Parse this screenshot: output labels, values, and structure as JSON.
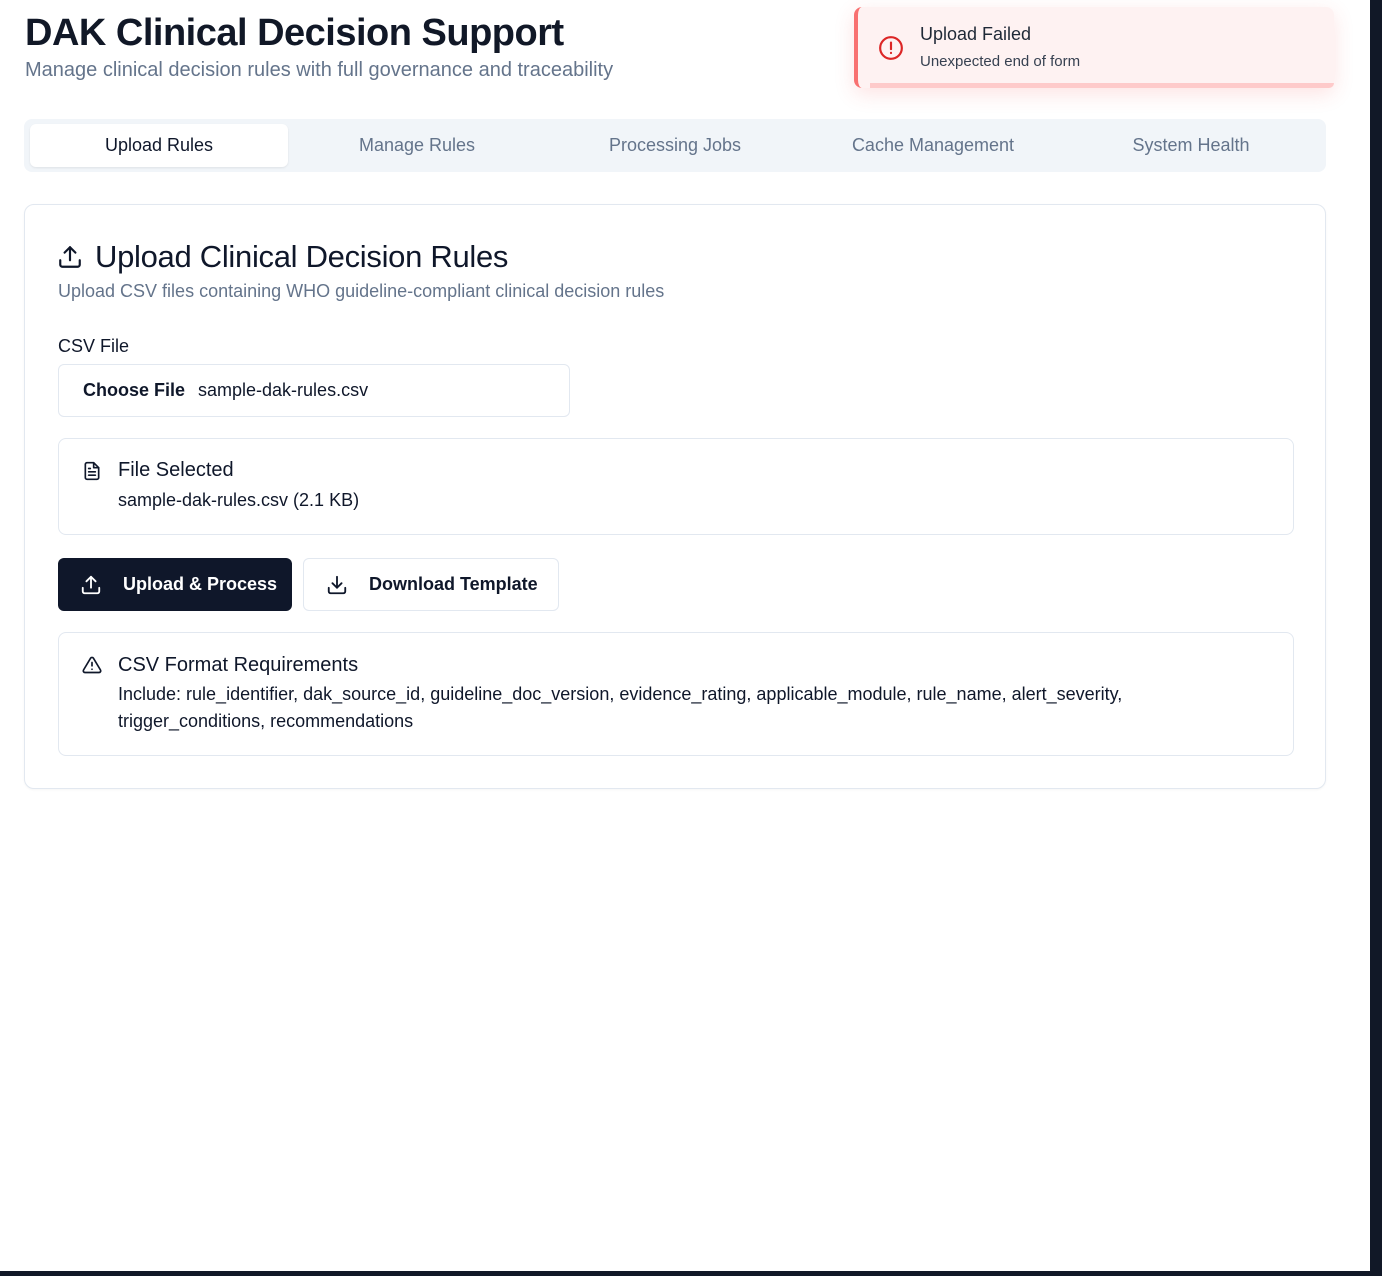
{
  "header": {
    "title": "DAK Clinical Decision Support",
    "subtitle": "Manage clinical decision rules with full governance and traceability"
  },
  "toast": {
    "title": "Upload Failed",
    "message": "Unexpected end of form",
    "icon": "alert-circle-icon",
    "accent": "#ef4444"
  },
  "tabs": [
    {
      "label": "Upload Rules",
      "active": true
    },
    {
      "label": "Manage Rules",
      "active": false
    },
    {
      "label": "Processing Jobs",
      "active": false
    },
    {
      "label": "Cache Management",
      "active": false
    },
    {
      "label": "System Health",
      "active": false
    }
  ],
  "upload_card": {
    "title": "Upload Clinical Decision Rules",
    "subtitle": "Upload CSV files containing WHO guideline-compliant clinical decision rules",
    "field_label": "CSV File",
    "file_button": "Choose File",
    "file_name": "sample-dak-rules.csv",
    "file_selected": {
      "title": "File Selected",
      "detail": "sample-dak-rules.csv (2.1 KB)"
    },
    "actions": {
      "upload_label": "Upload & Process",
      "download_label": "Download Template"
    },
    "requirements": {
      "title": "CSV Format Requirements",
      "detail": "Include: rule_identifier, dak_source_id, guideline_doc_version, evidence_rating, applicable_module, rule_name, alert_severity, trigger_conditions, recommendations"
    }
  },
  "colors": {
    "primary": "#0f172a",
    "muted_text": "#64748b",
    "border": "#e2e8f0",
    "tab_bg": "#f1f5f9",
    "error_bg": "#fef2f2",
    "error": "#dc2626"
  }
}
